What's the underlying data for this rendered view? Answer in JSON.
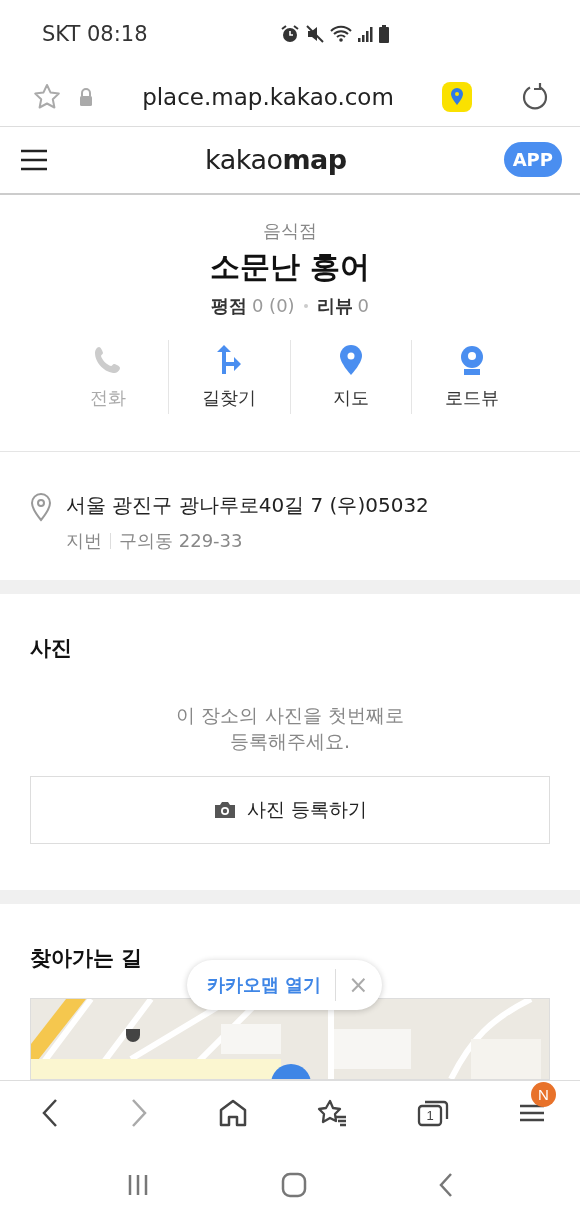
{
  "status_bar": {
    "carrier_time": "SKT 08:18"
  },
  "url_bar": {
    "url": "place.map.kakao.com"
  },
  "header": {
    "logo_light": "kakao",
    "logo_bold": "map",
    "app_button": "APP"
  },
  "place": {
    "category": "음식점",
    "name": "소문난 홍어",
    "rating_label": "평점",
    "rating_value": "0 (0)",
    "review_label": "리뷰",
    "review_value": "0"
  },
  "actions": [
    {
      "kind": "phone",
      "label": "전화",
      "disabled": true
    },
    {
      "kind": "route",
      "label": "길찾기",
      "disabled": false
    },
    {
      "kind": "map",
      "label": "지도",
      "disabled": false
    },
    {
      "kind": "roadview",
      "label": "로드뷰",
      "disabled": false
    }
  ],
  "address": {
    "road": "서울 광진구 광나루로40길 7 (우)05032",
    "lot_label": "지번",
    "lot": "구의동 229-33"
  },
  "photos": {
    "title": "사진",
    "empty_message": "이 장소의 사진을 첫번째로\n등록해주세요.",
    "button": "사진 등록하기"
  },
  "directions": {
    "title": "찾아가는 길"
  },
  "open_app_popup": {
    "label": "카카오맵 열기",
    "close": "×"
  },
  "toolbar": {
    "buttons": [
      {
        "kind": "back",
        "disabled": false
      },
      {
        "kind": "forward",
        "disabled": true
      },
      {
        "kind": "home",
        "disabled": false
      },
      {
        "kind": "bookmarks",
        "disabled": false
      },
      {
        "kind": "tabs",
        "disabled": false,
        "count": "1"
      },
      {
        "kind": "menu",
        "disabled": false,
        "badge": "N"
      }
    ]
  }
}
